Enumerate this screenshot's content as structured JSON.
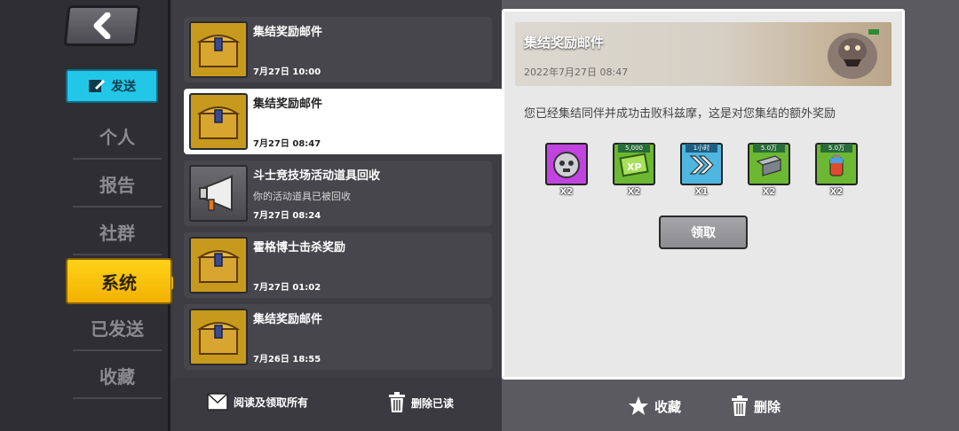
{
  "sidebar": {
    "send_label": "发送",
    "items": [
      {
        "label": "个人"
      },
      {
        "label": "报告"
      },
      {
        "label": "社群"
      },
      {
        "label": "系统"
      },
      {
        "label": "已发送"
      },
      {
        "label": "收藏"
      }
    ],
    "active_item": "系统"
  },
  "mails": [
    {
      "title": "集结奖励邮件",
      "subtitle": "",
      "date": "7月27日 10:00",
      "icon": "treasure-chest-icon"
    },
    {
      "title": "集结奖励邮件",
      "subtitle": "",
      "date": "7月27日 08:47",
      "icon": "treasure-chest-icon"
    },
    {
      "title": "斗士竞技场活动道具回收",
      "subtitle": "你的活动道具已被回收",
      "date": "7月27日 08:24",
      "icon": "megaphone-icon"
    },
    {
      "title": "霍格博士击杀奖励",
      "subtitle": "",
      "date": "7月27日 01:02",
      "icon": "treasure-chest-icon"
    },
    {
      "title": "集结奖励邮件",
      "subtitle": "",
      "date": "7月26日 18:55",
      "icon": "treasure-chest-icon"
    }
  ],
  "list_actions": {
    "read_all_label": "阅读及领取所有",
    "delete_read_label": "删除已读"
  },
  "detail": {
    "title": "集结奖励邮件",
    "date": "2022年7月27日 08:47",
    "message": "您已经集结同伴并成功击败科兹摩，这是对您集结的额外奖励",
    "rewards": [
      {
        "icon": "skull-medal-icon",
        "tag": "",
        "count": "X2",
        "color": "#c244e0"
      },
      {
        "icon": "xp-book-icon",
        "tag": "5,000",
        "count": "X2",
        "color": "#6cb832"
      },
      {
        "icon": "speedup-icon",
        "tag": "1小时",
        "count": "X1",
        "color": "#4fb6e0"
      },
      {
        "icon": "steel-beam-icon",
        "tag": "5.0万",
        "count": "X2",
        "color": "#6cb832"
      },
      {
        "icon": "fuel-canister-icon",
        "tag": "5.0万",
        "count": "X2",
        "color": "#6cb832"
      }
    ],
    "claim_label": "领取",
    "favorite_label": "收藏",
    "delete_label": "删除"
  }
}
